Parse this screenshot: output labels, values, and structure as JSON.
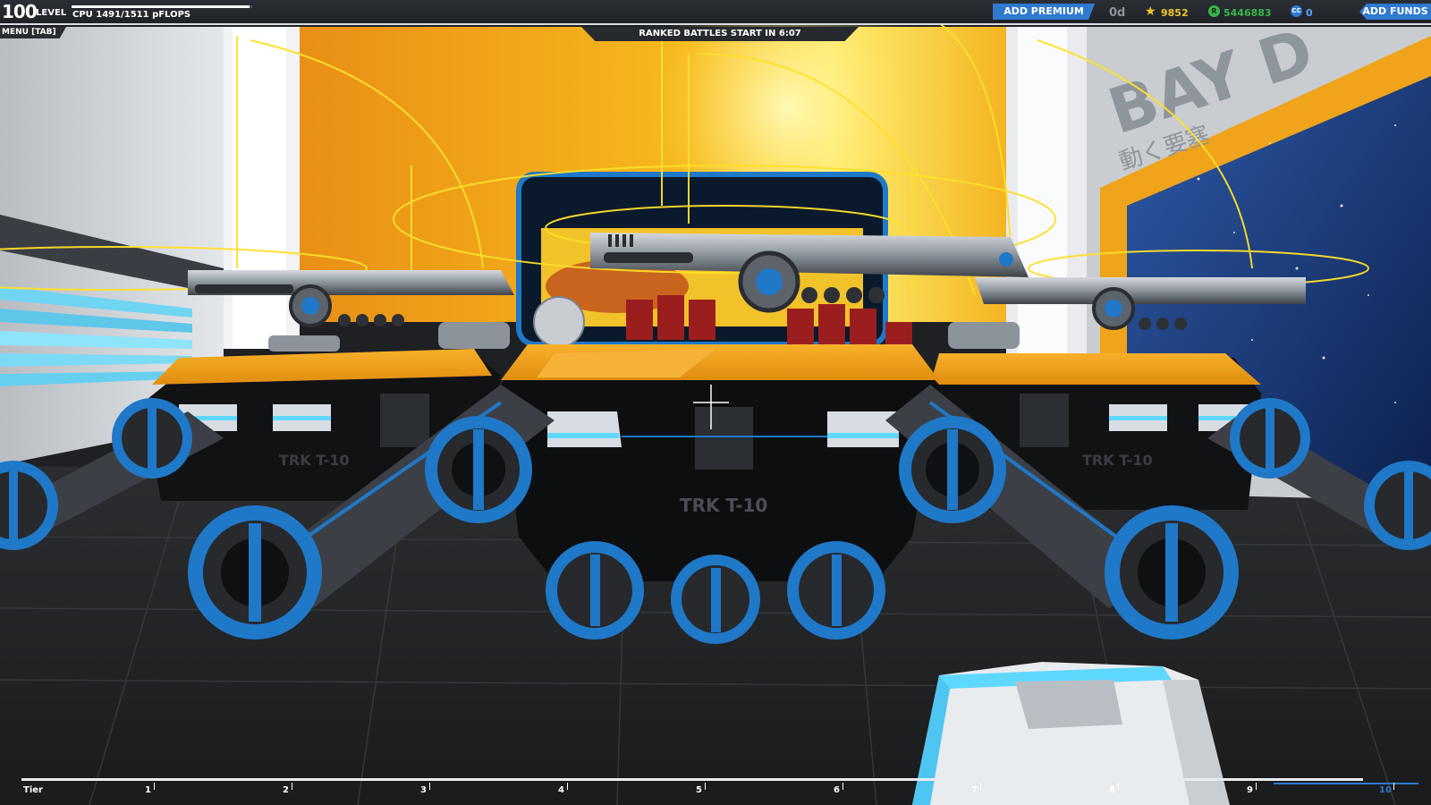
{
  "hud": {
    "level": "100",
    "level_label": "LEVEL",
    "cpu_text": "CPU 1491/1511 pFLOPS",
    "cpu_fill_fraction": 0.987,
    "add_premium_label": "ADD PREMIUM",
    "premium_days": "0d",
    "robit_points": "9852",
    "robits": "5446883",
    "cosmetic_credits": "0",
    "add_funds_label": "ADD FUNDS",
    "menu_label": "MENU [TAB]",
    "ranked_banner": "RANKED BATTLES START IN 6:07"
  },
  "icons": {
    "rp": "star-tier-icon",
    "money": "robits-coin-icon",
    "cosmetic": "cosmetic-credit-icon"
  },
  "scene": {
    "robot_badge_center": "TRK T-10",
    "robot_badge_left": "TRK T-10",
    "robot_badge_right": "TRK T-10",
    "wall_sign": "BAY D",
    "wall_sign_jp": "動く要塞"
  },
  "tier_bar": {
    "label": "Tier",
    "ticks": [
      "1",
      "2",
      "3",
      "4",
      "5",
      "6",
      "7",
      "8",
      "9",
      "10"
    ]
  },
  "colors": {
    "accent_blue": "#2f79d0",
    "robot_orange": "#f2a21e",
    "gold": "#f1c62b",
    "green": "#39b44a"
  }
}
